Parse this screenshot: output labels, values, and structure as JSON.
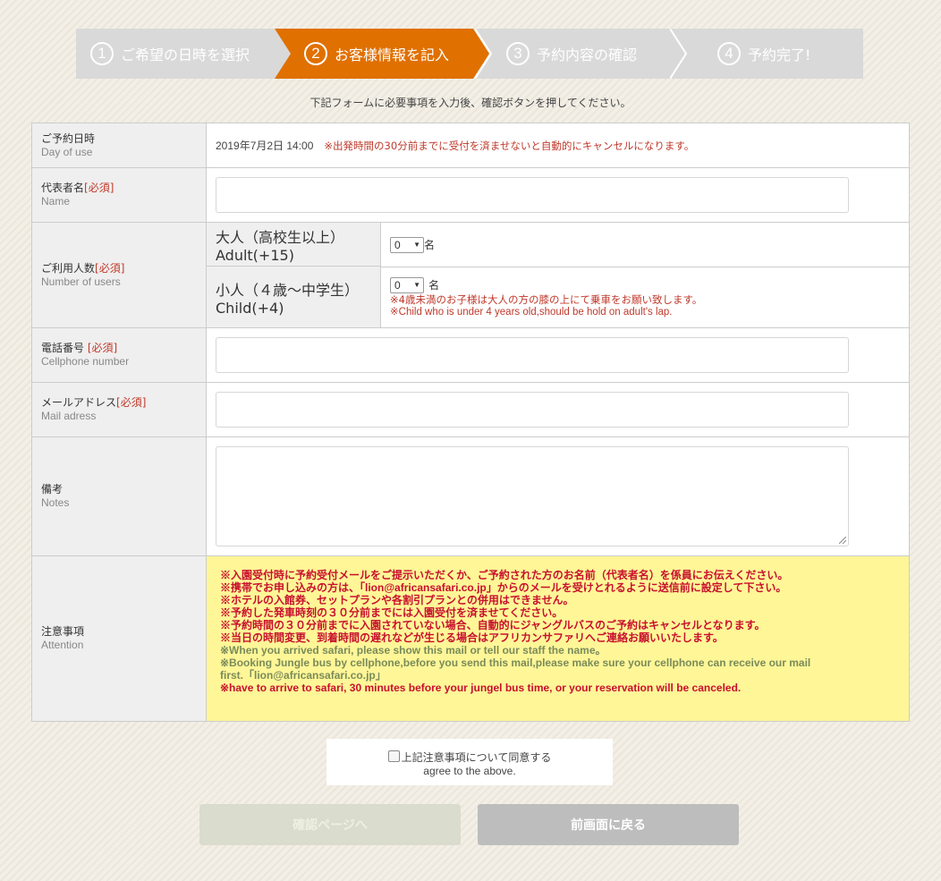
{
  "steps": [
    {
      "num": "1",
      "label": "ご希望の日時を選択"
    },
    {
      "num": "2",
      "label": "お客様情報を記入"
    },
    {
      "num": "3",
      "label": "予約内容の確認"
    },
    {
      "num": "4",
      "label": "予約完了!"
    }
  ],
  "colors": {
    "step_active": "#e07000",
    "step_inactive": "#d9d9d9",
    "required": "#c0392b",
    "attention_bg": "#fef697"
  },
  "lead_text": "下記フォームに必要事項を入力後、確認ボタンを押してください。",
  "form": {
    "date": {
      "label_jp": "ご予約日時",
      "label_en": "Day of use",
      "value": "2019年7月2日 14:00",
      "notice": "※出発時間の30分前までに受付を済ませないと自動的にキャンセルになります。"
    },
    "name": {
      "label_jp": "代表者名",
      "required": "[必須]",
      "label_en": "Name",
      "value": ""
    },
    "users": {
      "label_jp": "ご利用人数",
      "required": "[必須]",
      "label_en": "Number of users",
      "adult": {
        "label_jp": "大人（高校生以上）",
        "label_en": "Adult(+15)",
        "selected": "0",
        "unit": "名"
      },
      "child": {
        "label_jp": "小人（４歳〜中学生）",
        "label_en": "Child(+4)",
        "selected": "0",
        "unit": "名",
        "note_jp": "※4歳未満のお子様は大人の方の膝の上にて乗車をお願い致します。",
        "note_en": "※Child who is under 4 years old,should be hold on adult's lap."
      }
    },
    "phone": {
      "label_jp": "電話番号 ",
      "required": "[必須]",
      "label_en": "Cellphone number",
      "value": ""
    },
    "mail": {
      "label_jp": "メールアドレス",
      "required": "[必須]",
      "label_en": "Mail adress",
      "value": ""
    },
    "notes": {
      "label_jp": "備考",
      "label_en": "Notes",
      "value": ""
    },
    "attention": {
      "label_jp": "注意事項",
      "label_en": "Attention",
      "lines": [
        {
          "text": "※入園受付時に予約受付メールをご提示いただくか、ご予約された方のお名前（代表者名）を係員にお伝えください。",
          "color": "red"
        },
        {
          "text": "※携帯でお申し込みの方は、「lion@africansafari.co.jp」からのメールを受けとれるように送信前に設定して下さい。",
          "color": "red"
        },
        {
          "text": "※ホテルの入館券、セットプランや各割引プランとの併用はできません。",
          "color": "red"
        },
        {
          "text": "※予約した発車時刻の３０分前までには入園受付を済ませてください。",
          "color": "red"
        },
        {
          "text": "※予約時間の３０分前までに入園されていない場合、自動的にジャングルバスのご予約はキャンセルとなります。",
          "color": "red"
        },
        {
          "text": "※当日の時間変更、到着時間の遅れなどが生じる場合はアフリカンサファリへご連絡お願いいたします。",
          "color": "red"
        },
        {
          "text": "※When you arrived safari, please show this mail or tell our staff the name。",
          "color": "green"
        },
        {
          "text": "※Booking Jungle bus by cellphone,before you send this mail,please make sure your cellphone can receive our mail",
          "color": "green"
        },
        {
          "text": "first.「lion@africansafari.co.jp」",
          "color": "green"
        },
        {
          "text": "※have to arrive to safari, 30 minutes before your jungel bus time, or your reservation will be canceled.",
          "color": "red"
        }
      ]
    }
  },
  "agree": {
    "label_jp": "上記注意事項について同意する",
    "label_en": "agree to the above.",
    "checked": false
  },
  "buttons": {
    "confirm": "確認ページへ",
    "back": "前画面に戻る"
  }
}
